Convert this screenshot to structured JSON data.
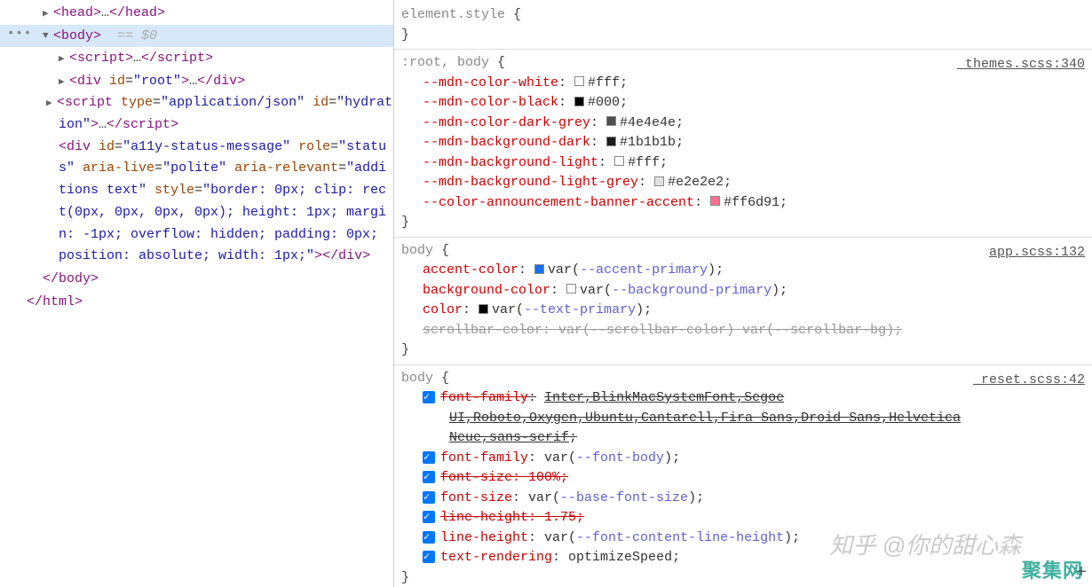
{
  "dom": {
    "head_open": "<head>",
    "head_dots": "…",
    "head_close": "</head>",
    "body_open": "<body>",
    "body_hint": "== $0",
    "script1_open": "<script>",
    "script1_dots": "…",
    "script1_close": "</script>",
    "div_root_open": "<div ",
    "div_root_attr_id": "id",
    "div_root_val_id": "\"root\"",
    "div_root_gt": ">",
    "div_root_dots": "…",
    "div_root_close": "</div>",
    "script2_full": "<script type=\"application/json\" id=\"hydration\">…</script>",
    "a11y_full": "<div id=\"a11y-status-message\" role=\"status\" aria-live=\"polite\" aria-relevant=\"additions text\" style=\"border: 0px; clip: rect(0px, 0px, 0px, 0px); height: 1px; margin: -1px; overflow: hidden; padding: 0px; position: absolute; width: 1px;\"></div>",
    "body_close": "</body>",
    "html_close": "</html>"
  },
  "styles": {
    "element_style": {
      "selector": "element.style",
      "open": "{",
      "close": "}"
    },
    "themes": {
      "selector": ":root, body",
      "open": "{",
      "source": "_themes.scss:340",
      "props": [
        {
          "name": "--mdn-color-white",
          "swatch": "#ffffff",
          "value": "#fff"
        },
        {
          "name": "--mdn-color-black",
          "swatch": "#000000",
          "value": "#000"
        },
        {
          "name": "--mdn-color-dark-grey",
          "swatch": "#4e4e4e",
          "value": "#4e4e4e"
        },
        {
          "name": "--mdn-background-dark",
          "swatch": "#1b1b1b",
          "value": "#1b1b1b"
        },
        {
          "name": "--mdn-background-light",
          "swatch": "#ffffff",
          "value": "#fff"
        },
        {
          "name": "--mdn-background-light-grey",
          "swatch": "#e2e2e2",
          "value": "#e2e2e2"
        },
        {
          "name": "--color-announcement-banner-accent",
          "swatch": "#ff6d91",
          "value": "#ff6d91"
        }
      ],
      "close": "}"
    },
    "app": {
      "selector": "body",
      "open": "{",
      "source": "app.scss:132",
      "accent": {
        "name": "accent-color",
        "swatch": "#1870f0",
        "var": "--accent-primary"
      },
      "bg": {
        "name": "background-color",
        "swatch": "#ffffff",
        "var": "--background-primary"
      },
      "color": {
        "name": "color",
        "swatch": "#000000",
        "var": "--text-primary"
      },
      "scrollbar": "scrollbar-color: var(--scrollbar-color) var(--scrollbar-bg);",
      "close": "}"
    },
    "reset": {
      "selector": "body",
      "open": "{",
      "source": "_reset.scss:42",
      "ff_struck_1": "font-family",
      "ff_struck_val_1": "Inter,BlinkMacSystemFont,Segoe",
      "ff_struck_val_2": "UI,Roboto,Oxygen,Ubuntu,Cantarell,Fira Sans,Droid Sans,Helvetica",
      "ff_struck_val_3": "Neue,sans-serif",
      "ff": {
        "name": "font-family",
        "var": "--font-body"
      },
      "fs_struck": "font-size: 100%;",
      "fs": {
        "name": "font-size",
        "var": "--base-font-size"
      },
      "lh_struck": "line-height: 1.75;",
      "lh": {
        "name": "line-height",
        "var": "--font-content-line-height"
      },
      "tr": {
        "name": "text-rendering",
        "value": "optimizeSpeed"
      },
      "close": "}"
    }
  },
  "watermark1": "知乎 @你的甜心森",
  "watermark2": "聚集网"
}
